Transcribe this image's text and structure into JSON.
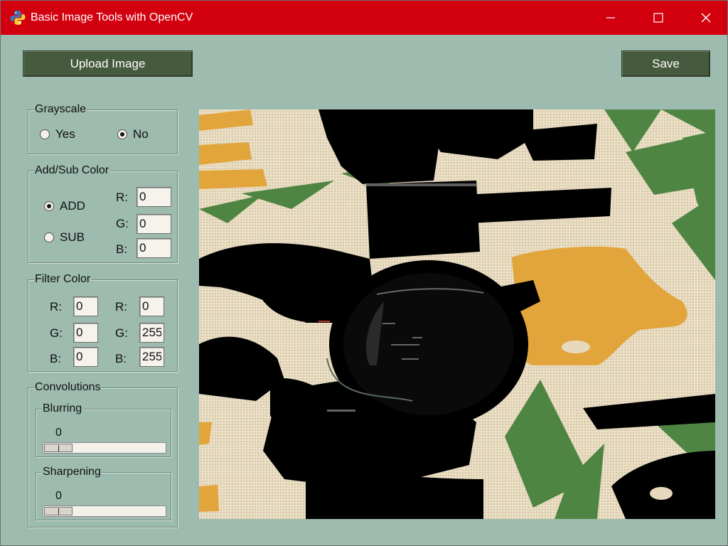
{
  "window": {
    "title": "Basic Image Tools with OpenCV"
  },
  "toolbar": {
    "upload_label": "Upload Image",
    "save_label": "Save"
  },
  "grayscale": {
    "title": "Grayscale",
    "yes_label": "Yes",
    "no_label": "No",
    "selected": "No"
  },
  "addsub": {
    "title": "Add/Sub Color",
    "add_label": "ADD",
    "sub_label": "SUB",
    "selected": "ADD",
    "r_label": "R:",
    "g_label": "G:",
    "b_label": "B:",
    "r": "0",
    "g": "0",
    "b": "0"
  },
  "filter": {
    "title": "Filter Color",
    "r_label": "R:",
    "g_label": "G:",
    "b_label": "B:",
    "low": {
      "r": "0",
      "g": "0",
      "b": "0"
    },
    "high": {
      "r": "0",
      "g": "255",
      "b": "255"
    }
  },
  "convolutions": {
    "title": "Convolutions",
    "blurring": {
      "title": "Blurring",
      "value": "0"
    },
    "sharpening": {
      "title": "Sharpening",
      "value": "0"
    }
  },
  "colors": {
    "titlebar": "#d3010f",
    "background": "#9dbbae",
    "button": "#465a3e",
    "mustard": "#e2a53c",
    "green": "#4f8543"
  },
  "icons": [
    "python-icon",
    "minimize-icon",
    "maximize-icon",
    "close-icon",
    "radio-icon"
  ]
}
